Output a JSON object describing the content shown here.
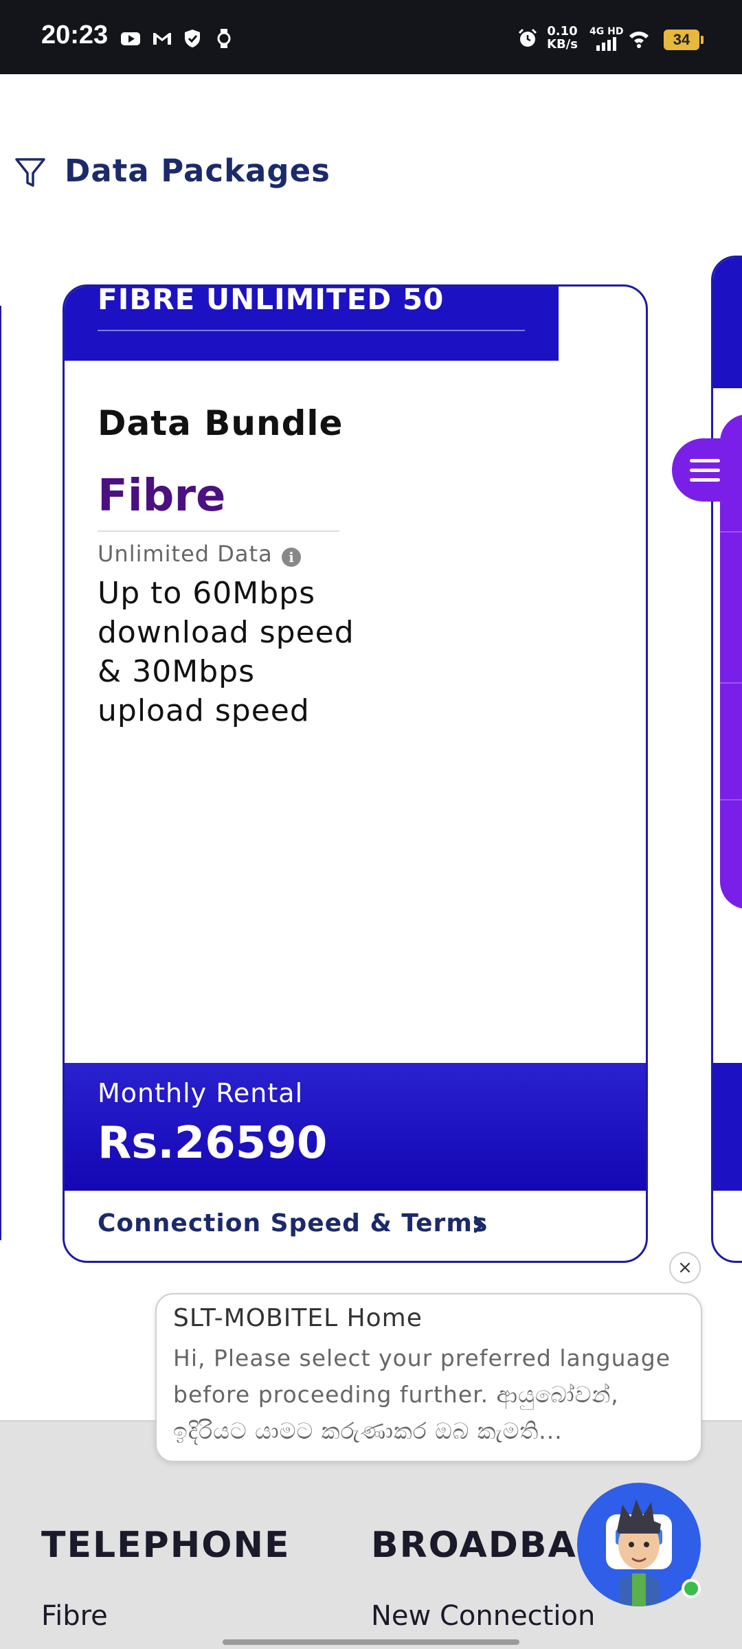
{
  "status_bar": {
    "time": "20:23",
    "speed_value": "0.10",
    "speed_unit": "KB/s",
    "network": "4G HD",
    "battery": "34"
  },
  "filter": {
    "title": "Data Packages"
  },
  "card": {
    "title": "FIBRE UNLIMITED 50",
    "bundle_label": "Data Bundle",
    "technology": "Fibre",
    "data_label": "Unlimited Data",
    "info_icon": "i",
    "speed_description": "Up to 60Mbps download speed & 30Mbps upload speed",
    "rental_label": "Monthly Rental",
    "rental_price": "Rs.26590",
    "terms_link": "Connection Speed & Terms"
  },
  "chat": {
    "close": "×",
    "title": "SLT-MOBITEL Home",
    "message": "Hi, Please select your preferred language before proceeding further. ආයුබෝවන්, ඉදිරියට යාමට කරුණාකර ඔබ කැමති..."
  },
  "footer": {
    "col1_heading": "TELEPHONE",
    "col1_link": "Fibre",
    "col2_heading": "BROADBAN",
    "col2_link": "New Connection"
  },
  "colors": {
    "brand_blue": "#1c12c4",
    "brand_purple": "#7a1fe8",
    "heading_navy": "#1b2a6b",
    "fibre_purple": "#4b1081"
  },
  "icons": [
    "youtube-icon",
    "gmail-icon",
    "shield-icon",
    "watch-icon",
    "alarm-icon",
    "signal-icon",
    "wifi-icon",
    "filter-icon",
    "menu-icon",
    "info-icon",
    "chevron-right-icon",
    "close-icon",
    "chatbot-avatar-icon"
  ]
}
